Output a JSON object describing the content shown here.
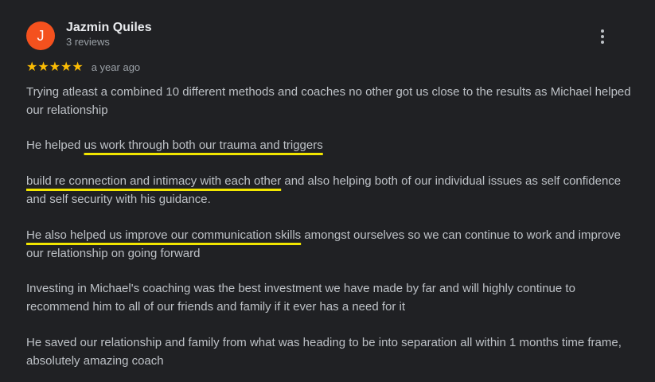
{
  "review": {
    "avatar_letter": "J",
    "author": "Jazmin Quiles",
    "review_count": "3 reviews",
    "stars": "★★★★★",
    "rating": 5,
    "time": "a year ago",
    "p1": "Trying atleast a combined 10 different methods and coaches no other got us close to the results as Michael helped our relationship",
    "p2_a": "He helped ",
    "p2_b": "us work through both our trauma and triggers",
    "p3_a": "build re connection and intimacy with each other",
    "p3_b": " and also helping both of our individual issues as self confidence and self security with his guidance.",
    "p4_a": "He also helped us improve our communication skills",
    "p4_b": " amongst ourselves so we can continue to work and improve our relationship on going forward",
    "p5": "Investing in Michael's coaching was the best investment we have made by far and will highly continue to recommend him to all of our friends and family if it ever has a need for it",
    "p6": "He saved our relationship and family from what was heading to be into separation all within 1 months time frame, absolutely amazing coach"
  },
  "colors": {
    "background": "#202124",
    "avatar": "#f4511e",
    "stars": "#fbbc04",
    "highlight_underline": "#f2e600"
  },
  "icons": {
    "menu": "more-vert-icon",
    "star": "star-icon"
  }
}
